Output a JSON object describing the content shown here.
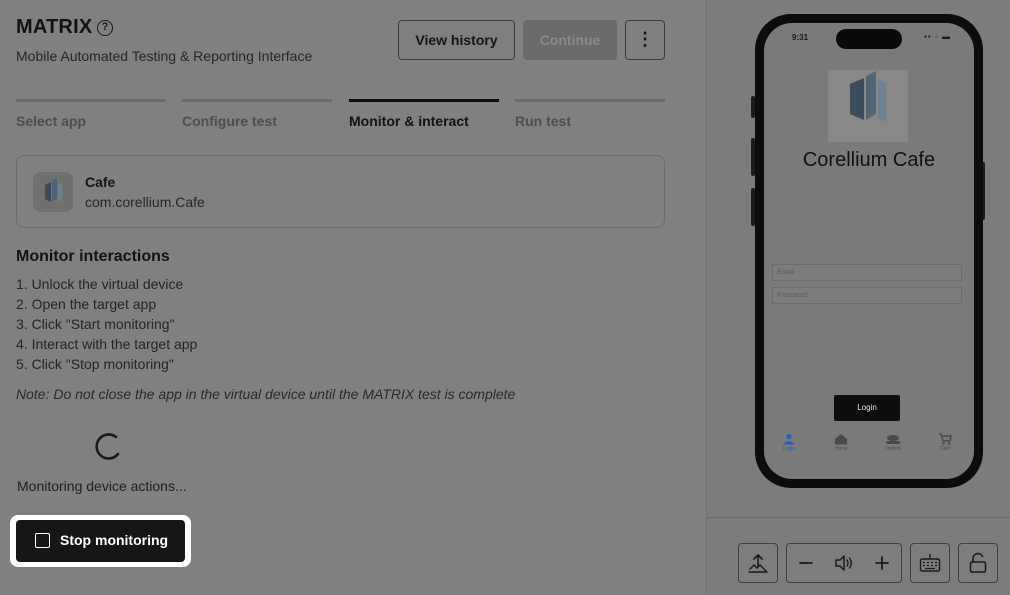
{
  "header": {
    "title": "MATRIX",
    "subtitle": "Mobile Automated Testing & Reporting Interface",
    "help_glyph": "?",
    "view_history_label": "View history",
    "continue_label": "Continue",
    "more_glyph": "⋮"
  },
  "steps": [
    {
      "label": "Select app",
      "active": false
    },
    {
      "label": "Configure test",
      "active": false
    },
    {
      "label": "Monitor & interact",
      "active": true
    },
    {
      "label": "Run test",
      "active": false
    }
  ],
  "app": {
    "name": "Cafe",
    "bundle_id": "com.corellium.Cafe"
  },
  "monitor": {
    "title": "Monitor interactions",
    "instructions": [
      "1. Unlock the virtual device",
      "2. Open the target app",
      "3. Click \"Start monitoring\"",
      "4. Interact with the target app",
      "5. Click \"Stop monitoring\""
    ],
    "note": "Note: Do not close the app in the virtual device until the MATRIX test is complete",
    "status": "Monitoring device actions...",
    "stop_label": "Stop monitoring"
  },
  "device": {
    "status_time": "9:31",
    "status_icons": "▪▪ ◦ ▬",
    "app_title": "Corellium Cafe",
    "email_placeholder": "Email",
    "password_placeholder": "Password",
    "login_label": "Login",
    "tabs": [
      {
        "label": "Login",
        "icon": "person-icon",
        "active": true
      },
      {
        "label": "Home",
        "icon": "home-icon",
        "active": false
      },
      {
        "label": "Orders",
        "icon": "orders-icon",
        "active": false
      },
      {
        "label": "Cart",
        "icon": "cart-icon",
        "active": false
      }
    ]
  },
  "controls": [
    {
      "name": "upload-icon"
    },
    {
      "name": "volume-down-icon"
    },
    {
      "name": "volume-icon"
    },
    {
      "name": "volume-up-icon"
    },
    {
      "name": "keyboard-icon"
    },
    {
      "name": "unlock-icon"
    }
  ],
  "colors": {
    "overlay": "#808080",
    "primary_dark": "#161616",
    "active_tab": "#1f5fbf"
  }
}
